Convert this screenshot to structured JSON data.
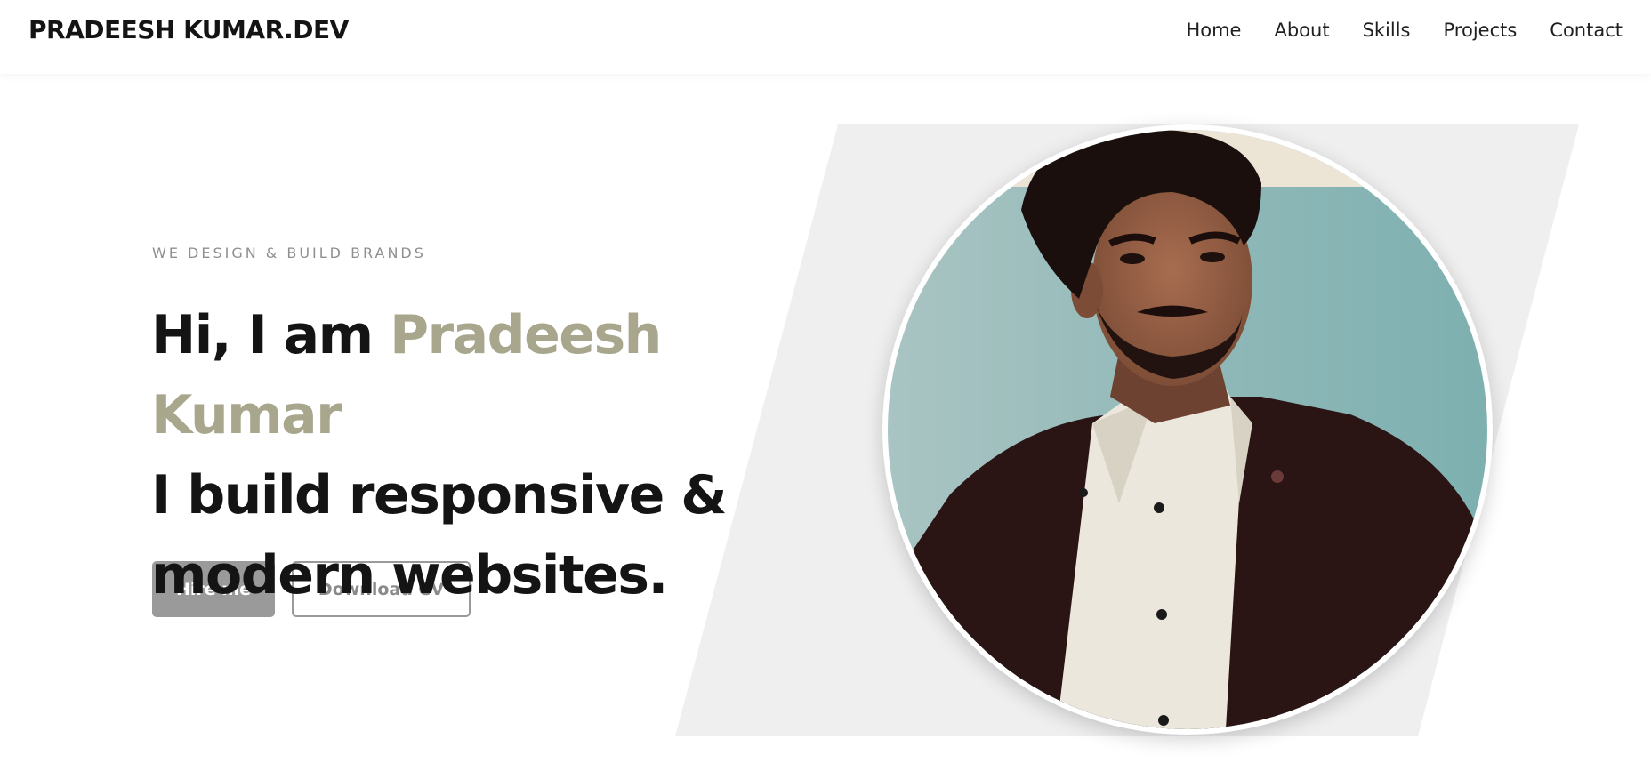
{
  "nav": {
    "brand": "PRADEESH KUMAR.DEV",
    "links": [
      "Home",
      "About",
      "Skills",
      "Projects",
      "Contact"
    ]
  },
  "hero": {
    "tagline": "WE DESIGN & BUILD BRANDS",
    "greeting": "Hi, I am ",
    "name": "Pradeesh Kumar",
    "line2": "I build responsive &",
    "line3": "modern websites.",
    "hire_label": "Hire me",
    "cv_label": "Download CV"
  },
  "colors": {
    "accent": "#a8a68c",
    "text": "#141414",
    "muted": "#8f8f8f",
    "button_gray": "#9a9a9a",
    "shape_gray": "#efefef"
  }
}
